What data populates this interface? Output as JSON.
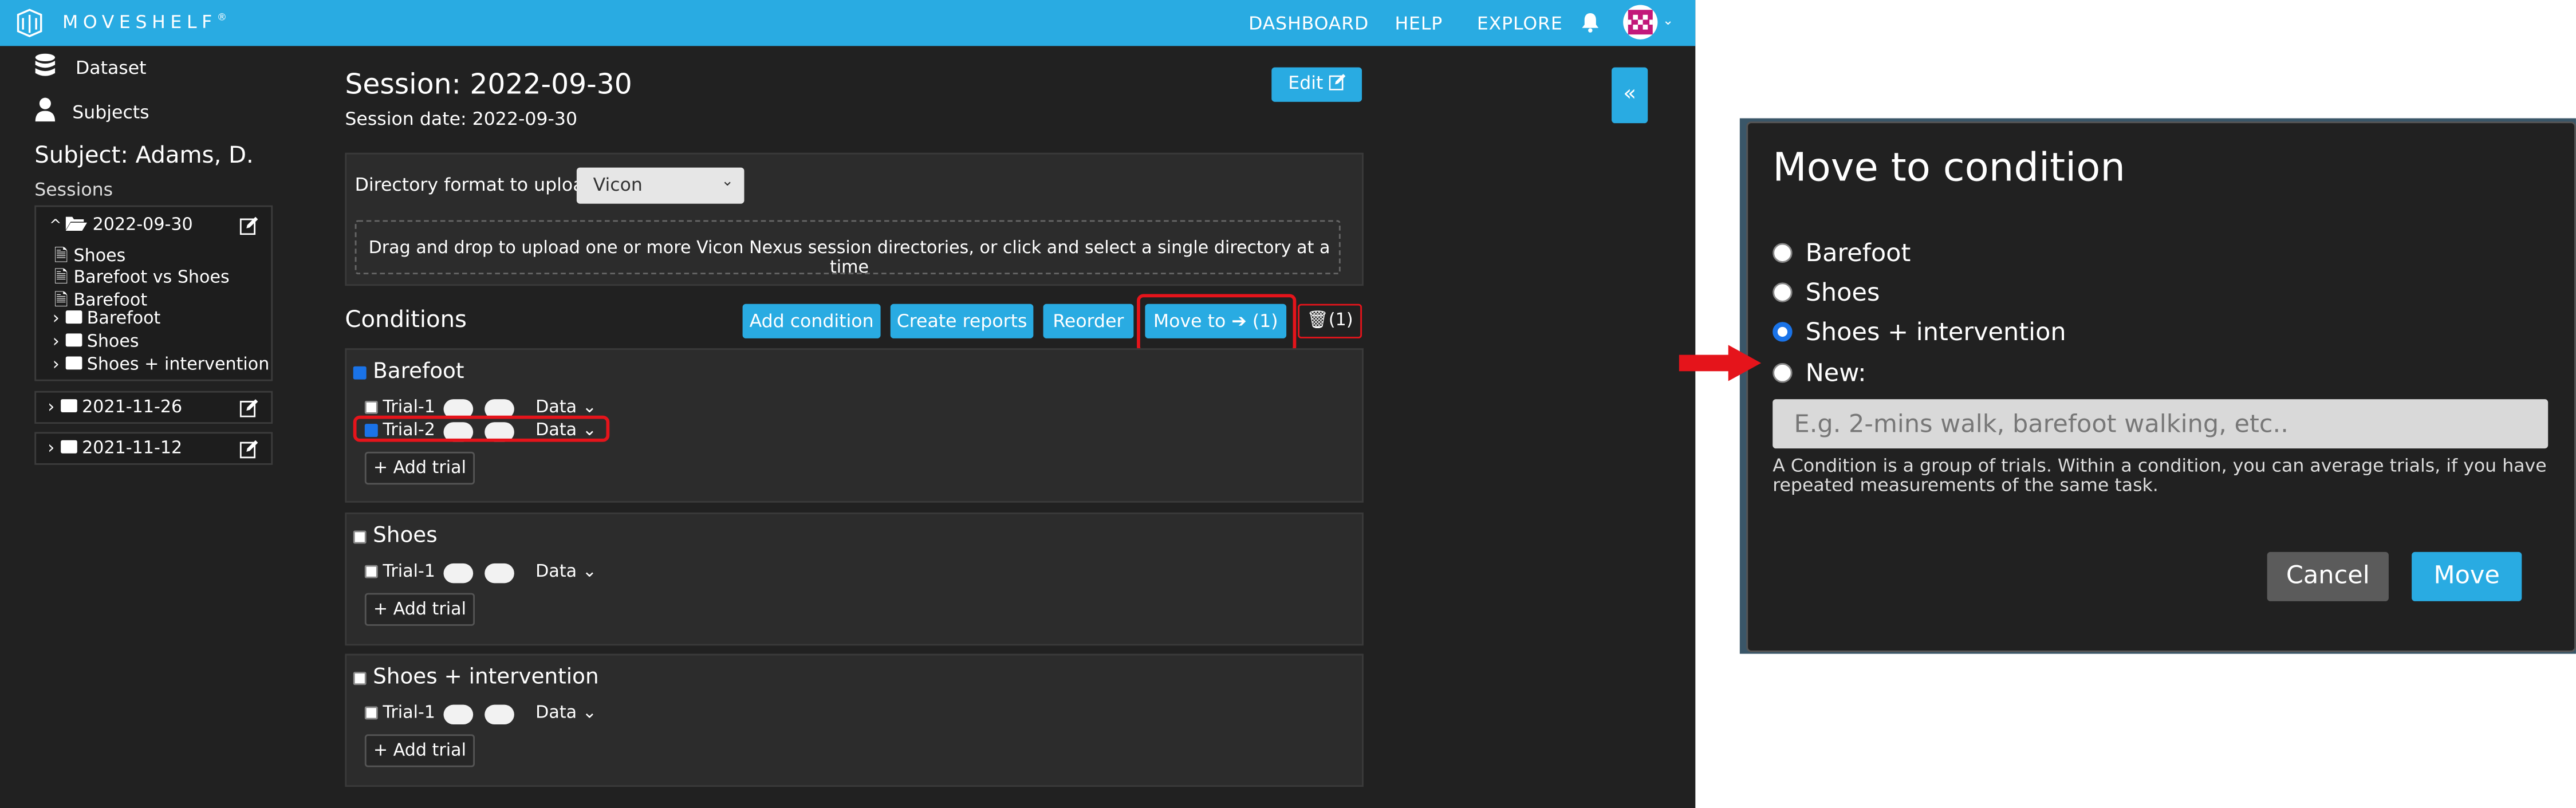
{
  "topbar": {
    "brand": "MOVESHELF",
    "brand_mark": "®",
    "nav": [
      "DASHBOARD",
      "HELP",
      "EXPLORE"
    ]
  },
  "sidebar": {
    "links": [
      {
        "label": "Dataset",
        "icon": "database-icon"
      },
      {
        "label": "Subjects",
        "icon": "user-icon"
      }
    ],
    "subject_title": "Subject: Adams, D.",
    "sessions_label": "Sessions",
    "sessions": [
      {
        "date": "2022-09-30",
        "expanded": true,
        "reports": [
          "Shoes",
          "Barefoot vs Shoes",
          "Barefoot"
        ],
        "folders": [
          "Barefoot",
          "Shoes",
          "Shoes + intervention"
        ]
      },
      {
        "date": "2021-11-26",
        "expanded": false
      },
      {
        "date": "2021-11-12",
        "expanded": false
      }
    ]
  },
  "main": {
    "title": "Session: 2022-09-30",
    "date_label": "Session date: 2022-09-30",
    "edit_label": "Edit",
    "upload": {
      "label": "Directory format to upload",
      "format_selected": "Vicon",
      "drop_text": "Drag and drop to upload one or more Vicon Nexus session directories, or click and select a single directory at a time"
    },
    "conditions_title": "Conditions",
    "actions": {
      "add_condition": "Add condition",
      "create_reports": "Create reports",
      "reorder": "Reorder",
      "move_to": "Move to",
      "move_count": "(1)",
      "delete_count": "(1)"
    },
    "conditions": [
      {
        "name": "Barefoot",
        "checked": true,
        "trials": [
          {
            "name": "Trial-1",
            "checked": false
          },
          {
            "name": "Trial-2",
            "checked": true
          }
        ]
      },
      {
        "name": "Shoes",
        "checked": false,
        "trials": [
          {
            "name": "Trial-1",
            "checked": false
          }
        ]
      },
      {
        "name": "Shoes + intervention",
        "checked": false,
        "trials": [
          {
            "name": "Trial-1",
            "checked": false
          }
        ]
      }
    ],
    "data_label": "Data",
    "add_trial_label": "+ Add trial"
  },
  "dialog": {
    "title": "Move to condition",
    "options": [
      {
        "label": "Barefoot",
        "selected": false
      },
      {
        "label": "Shoes",
        "selected": false
      },
      {
        "label": "Shoes + intervention",
        "selected": true
      },
      {
        "label": "New:",
        "selected": false
      }
    ],
    "new_placeholder": "E.g. 2-mins walk, barefoot walking, etc..",
    "help_text": "A Condition is a group of trials. Within a condition, you can average trials, if you have repeated measurements of the same task.",
    "cancel_label": "Cancel",
    "move_label": "Move"
  },
  "colors": {
    "accent": "#29abe2",
    "highlight": "#e5141b",
    "background": "#212121"
  }
}
